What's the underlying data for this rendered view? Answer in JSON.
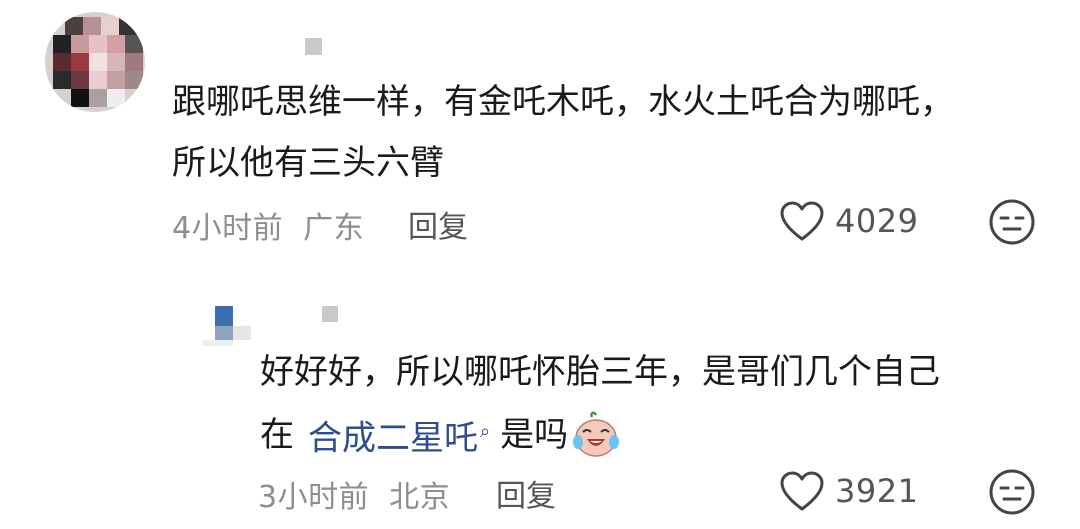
{
  "comment": {
    "text_line1": "跟哪吒思维一样，有金吒木吒，水火土吒合为哪吒，",
    "text_line2": "所以他有三头六臂",
    "time": "4小时前",
    "location": "广东",
    "reply_label": "回复",
    "likes": "4029",
    "react_icon": "expressionless-face-icon"
  },
  "reply": {
    "text_line1": "好好好，所以哪吒怀胎三年，是哥们几个自己",
    "text_prefix": "在",
    "link_text": "合成二星吒",
    "link_suffix": "是吗",
    "emoji": "crying-laughing-baby-icon",
    "time": "3小时前",
    "location": "北京",
    "reply_label": "回复",
    "likes": "3921",
    "react_icon": "expressionless-face-icon"
  },
  "colors": {
    "text": "#1a1a1a",
    "meta": "#8e8e8e",
    "link": "#2d4e8a"
  }
}
